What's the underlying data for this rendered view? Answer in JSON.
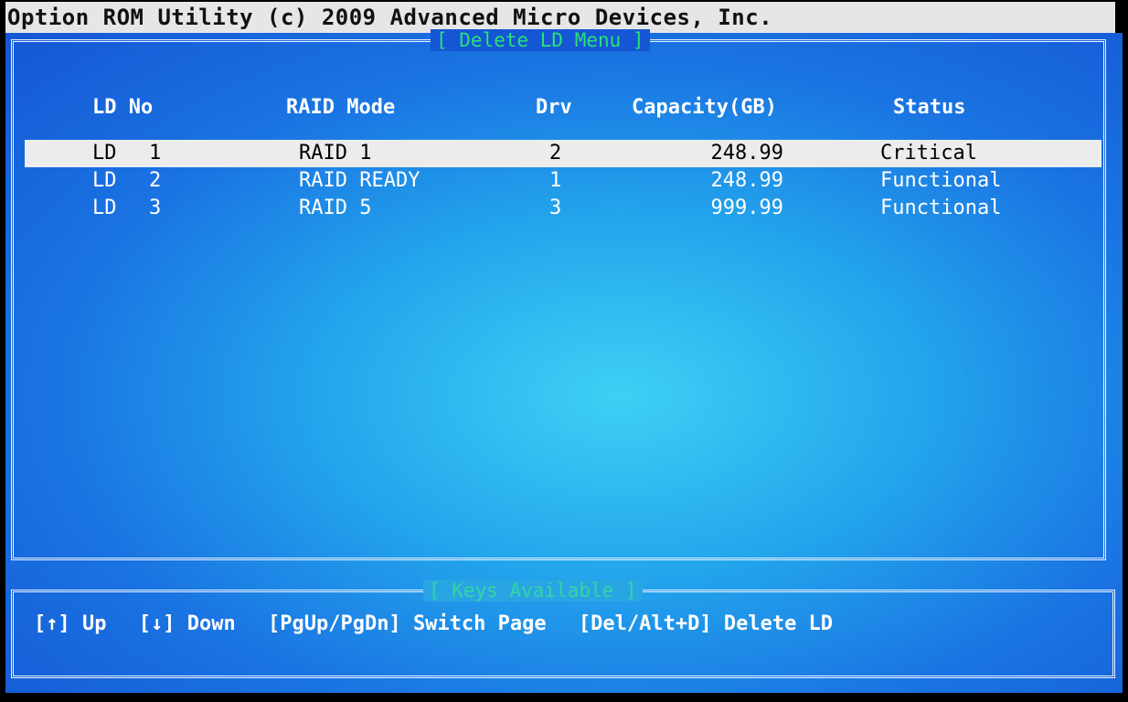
{
  "header": {
    "title": "Option ROM Utility (c) 2009 Advanced Micro Devices, Inc."
  },
  "main_panel": {
    "title": "[ Delete LD Menu ]",
    "columns": {
      "ld_no": "LD No",
      "raid_mode": "RAID Mode",
      "drv": "Drv",
      "capacity": "Capacity(GB)",
      "status": "Status"
    },
    "rows": [
      {
        "ld_label": "LD",
        "ld_num": "1",
        "raid_mode": "RAID 1",
        "drv": "2",
        "capacity": "248.99",
        "status": "Critical",
        "selected": true
      },
      {
        "ld_label": "LD",
        "ld_num": "2",
        "raid_mode": "RAID READY",
        "drv": "1",
        "capacity": "248.99",
        "status": "Functional",
        "selected": false
      },
      {
        "ld_label": "LD",
        "ld_num": "3",
        "raid_mode": "RAID 5",
        "drv": "3",
        "capacity": "999.99",
        "status": "Functional",
        "selected": false
      }
    ]
  },
  "keys_panel": {
    "title": "[ Keys Available ]",
    "keys": [
      {
        "key": "[↑]",
        "action": "Up"
      },
      {
        "key": "[↓]",
        "action": "Down"
      },
      {
        "key": "[PgUp/PgDn]",
        "action": "Switch Page"
      },
      {
        "key": "[Del/Alt+D]",
        "action": "Delete LD"
      }
    ]
  },
  "colors": {
    "background_blue": "#1556d4",
    "highlight_row": "#ececec",
    "title_green": "#2ae07a",
    "title_bar": "#e6e6e6"
  }
}
